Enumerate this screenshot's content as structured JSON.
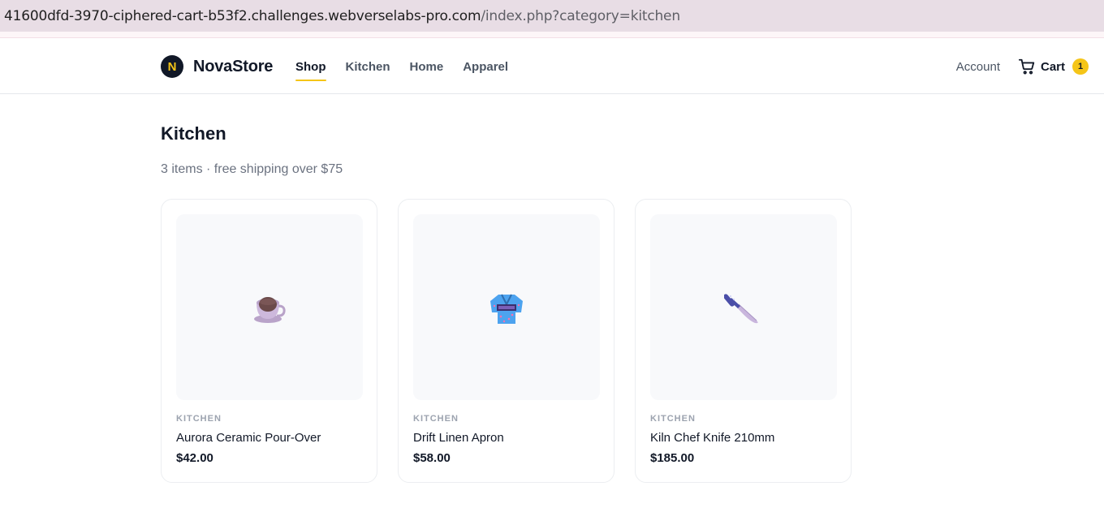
{
  "browser": {
    "url_host": "41600dfd-3970-ciphered-cart-b53f2.challenges.webverselabs-pro.com",
    "url_path": "/index.php?category=kitchen"
  },
  "header": {
    "logo_letter": "N",
    "brand": "NovaStore",
    "nav": [
      {
        "label": "Shop",
        "active": true
      },
      {
        "label": "Kitchen",
        "active": false
      },
      {
        "label": "Home",
        "active": false
      },
      {
        "label": "Apparel",
        "active": false
      }
    ],
    "account_label": "Account",
    "cart_label": "Cart",
    "cart_count": "1"
  },
  "main": {
    "title": "Kitchen",
    "subtitle": "3 items · free shipping over $75",
    "products": [
      {
        "category": "KITCHEN",
        "name": "Aurora Ceramic Pour-Over",
        "price": "$42.00",
        "icon": "teacup-icon"
      },
      {
        "category": "KITCHEN",
        "name": "Drift Linen Apron",
        "price": "$58.00",
        "icon": "kimono-icon"
      },
      {
        "category": "KITCHEN",
        "name": "Kiln Chef Knife 210mm",
        "price": "$185.00",
        "icon": "knife-icon"
      }
    ]
  },
  "colors": {
    "accent": "#f5c518",
    "text": "#111827",
    "muted": "#6b7280",
    "thumb_bg": "#f8f9fb"
  }
}
